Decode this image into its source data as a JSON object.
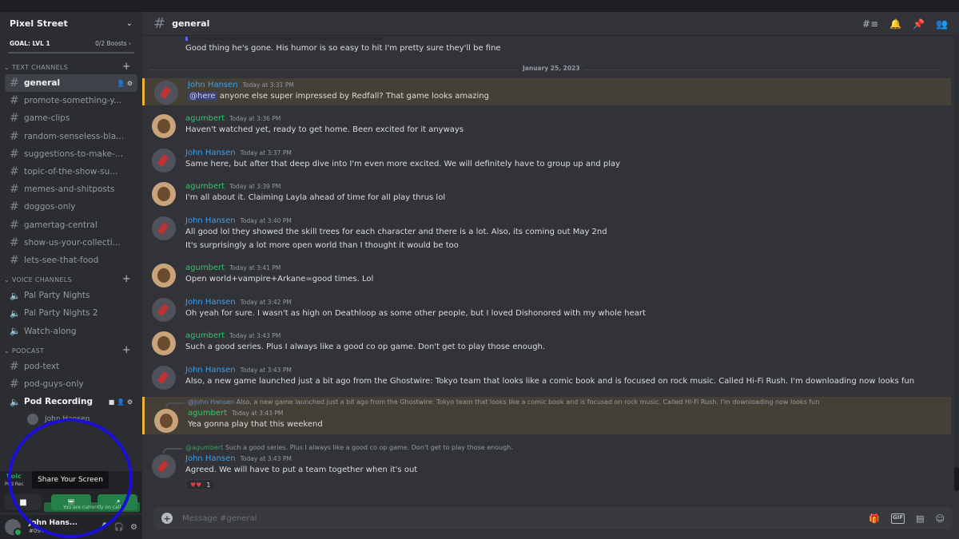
{
  "server": {
    "name": "Pixel Street",
    "goal": "GOAL: LVL 1",
    "boosts": "0/2 Boosts"
  },
  "categories": {
    "text": "TEXT CHANNELS",
    "voice": "VOICE CHANNELS",
    "podcast": "PODCAST"
  },
  "text_channels": [
    "general",
    "promote-something-y...",
    "game-clips",
    "random-senseless-bla...",
    "suggestions-to-make-...",
    "topic-of-the-show-su...",
    "memes-and-shitposts",
    "doggos-only",
    "gamertag-central",
    "show-us-your-collecti...",
    "lets-see-that-food"
  ],
  "voice_channels": [
    "Pal Party Nights",
    "Pal Party Nights 2",
    "Watch-along"
  ],
  "podcast_channels": {
    "text": "pod-text",
    "guys": "pod-guys-only",
    "recording": "Pod Recording",
    "voice_user": "John Hansen"
  },
  "panel": {
    "voice_connected": "Voic",
    "voice_sub": "Pod Rec",
    "tooltip": "Share Your Screen",
    "live_note": "You are currently on call"
  },
  "user": {
    "name": "John Hans...",
    "tag": "#094"
  },
  "channel_header": {
    "name": "general"
  },
  "fragment": "Good thing he's gone. His humor is so easy to hit I'm pretty sure they'll be fine",
  "date_divider": "January 25, 2023",
  "messages": [
    {
      "author": "John Hansen",
      "time": "Today at 3:31 PM",
      "mention": "@here",
      "text": "anyone else super impressed by Redfall? That game looks amazing"
    },
    {
      "author": "agumbert",
      "time": "Today at 3:36 PM",
      "text": "Haven't watched yet, ready to get home. Been excited for it anyways"
    },
    {
      "author": "John Hansen",
      "time": "Today at 3:37 PM",
      "text": "Same here, but after that deep dive into I'm even more excited. We will definitely have to group up and play"
    },
    {
      "author": "agumbert",
      "time": "Today at 3:39 PM",
      "text": "I'm all about it. Claiming Layla ahead of time for all play thrus lol"
    },
    {
      "author": "John Hansen",
      "time": "Today at 3:40 PM",
      "text": "All good lol they showed the skill trees for each character and there is a lot. Also, its coming out May 2nd",
      "text2": "It's surprisingly a lot more open world than I thought it would be too"
    },
    {
      "author": "agumbert",
      "time": "Today at 3:41 PM",
      "text": "Open world+vampire+Arkane=good times. Lol"
    },
    {
      "author": "John Hansen",
      "time": "Today at 3:42 PM",
      "text": "Oh yeah for sure. I wasn't as high on Deathloop as some other people, but I loved Dishonored with my whole heart"
    },
    {
      "author": "agumbert",
      "time": "Today at 3:43 PM",
      "text": "Such a good series. Plus I always like a good co op game. Don't get to play those enough."
    },
    {
      "author": "John Hansen",
      "time": "Today at 3:43 PM",
      "text": "Also, a new game launched just a bit ago from the Ghostwire: Tokyo team that looks like a comic book and is focused on rock music. Called Hi-Fi Rush. I'm downloading now looks fun"
    },
    {
      "author": "agumbert",
      "time": "Today at 3:43 PM",
      "reply_to": "@John Hansen",
      "reply_text": "Also, a new game launched just a bit ago from the Ghostwire: Tokyo team that looks like a comic book and is focused on rock music. Called Hi-Fi Rush. I'm downloading now looks fun",
      "text": "Yea gonna play that this weekend"
    },
    {
      "author": "John Hansen",
      "time": "Today at 3:43 PM",
      "reply_to": "@agumbert",
      "reply_text": "Such a good series. Plus I always like a good co op game. Don't get to play those enough.",
      "text": "Agreed. We will have to put a team together when it's out",
      "reaction_count": "1"
    }
  ],
  "input": {
    "placeholder": "Message #general"
  },
  "colors": {
    "accent": "#5865f2",
    "mention_bg": "#444037",
    "mention_border": "#f0b232",
    "john": "#3ea0ec",
    "agumbert": "#35c46c",
    "highlight_circle": "#1a0fd8"
  }
}
